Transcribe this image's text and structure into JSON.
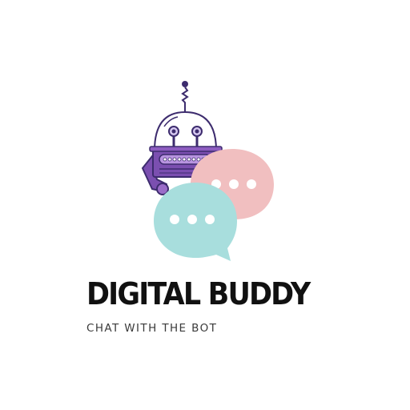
{
  "logo": {
    "title": "DIGITAL BUDDY",
    "tagline": "CHAT WITH THE BOT"
  },
  "icons": [
    "robot-icon",
    "chat-bubble-icon"
  ],
  "colors": {
    "background": "#ffffff",
    "robot_purple": "#7b4fb0",
    "robot_outline": "#3d2c6e",
    "bubble_pink": "#f1bfc0",
    "bubble_teal": "#a8dedd",
    "text": "#111111"
  }
}
